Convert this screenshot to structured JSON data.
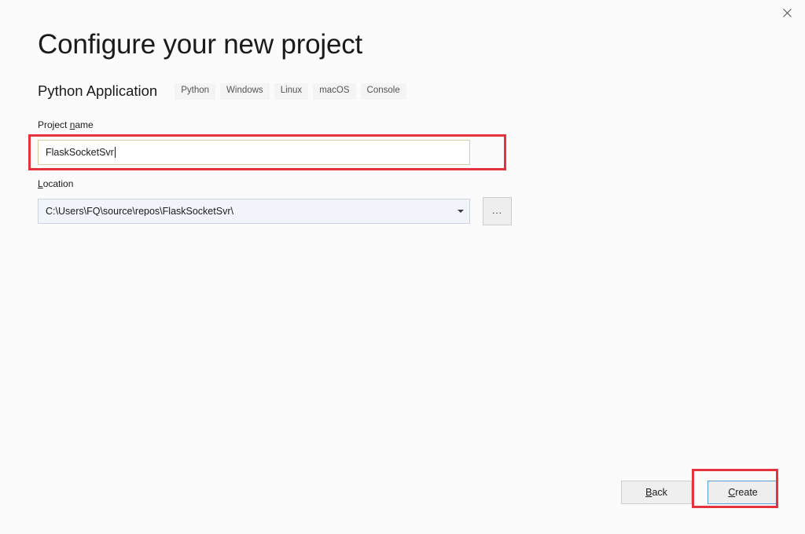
{
  "window": {
    "close_icon": "close-icon"
  },
  "header": {
    "title": "Configure your new project",
    "template_name": "Python Application",
    "tags": [
      "Python",
      "Windows",
      "Linux",
      "macOS",
      "Console"
    ]
  },
  "fields": {
    "project_name": {
      "label_prefix": "Project ",
      "label_accel": "n",
      "label_suffix": "ame",
      "value": "FlaskSocketSvr"
    },
    "location": {
      "label_accel": "L",
      "label_suffix": "ocation",
      "value": "C:\\Users\\FQ\\source\\repos\\FlaskSocketSvr\\",
      "browse_label": "...",
      "dropdown_icon": "chevron-down-icon"
    }
  },
  "footer": {
    "back": {
      "accel": "B",
      "rest": "ack"
    },
    "create": {
      "accel": "C",
      "rest": "reate"
    }
  },
  "annotations": {
    "accent_color": "#e6323c",
    "focus_border_color": "#5b9bd5",
    "input_border_color": "#d9cb9e",
    "combo_background_color": "#f1f4fa"
  }
}
